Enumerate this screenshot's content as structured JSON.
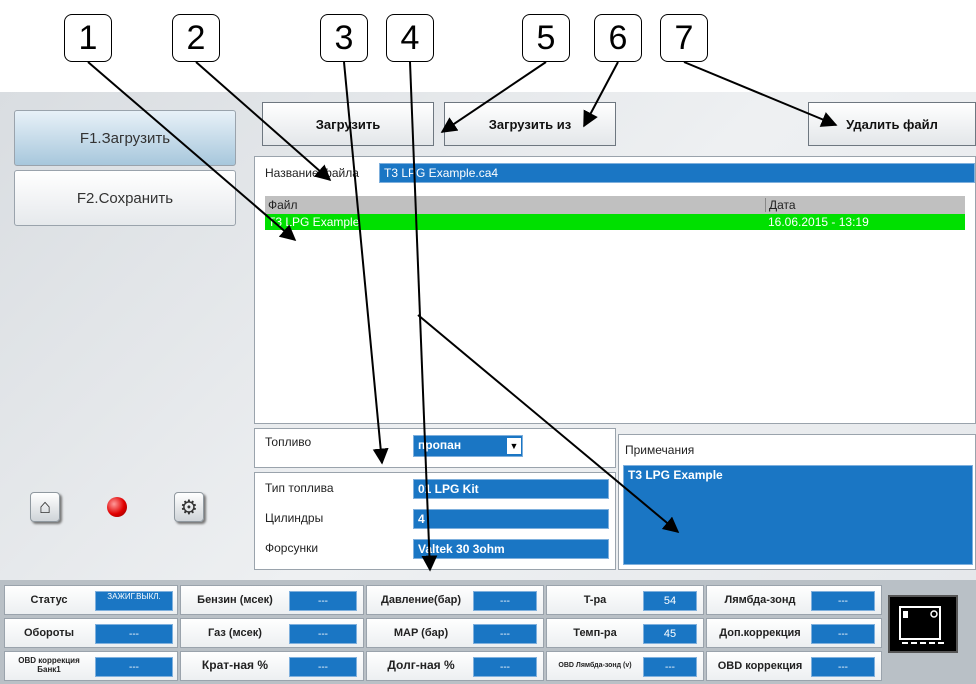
{
  "callouts": [
    "1",
    "2",
    "3",
    "4",
    "5",
    "6",
    "7"
  ],
  "sidebar": {
    "load_label": "F1.Загрузить",
    "save_label": "F2.Сохранить"
  },
  "toolbar": {
    "load": "Загрузить",
    "load_from": "Загрузить из",
    "delete": "Удалить файл"
  },
  "file": {
    "name_label": "Название файла",
    "name_value": "T3 LPG Example.ca4",
    "columns": [
      "Файл",
      "Дата"
    ],
    "rows": [
      {
        "name": "T3 LPG Example",
        "date": "16.06.2015 - 13:19"
      }
    ]
  },
  "fuel": {
    "label": "Топливо",
    "value": "пропан"
  },
  "info": {
    "fuel_type_label": "Тип топлива",
    "fuel_type_value": "01 LPG Kit",
    "cylinders_label": "Цилиндры",
    "cylinders_value": "4",
    "injectors_label": "Форсунки",
    "injectors_value": "Valtek 30 3ohm"
  },
  "notes": {
    "label": "Примечания",
    "value": "T3 LPG Example"
  },
  "status": {
    "status": "Статус",
    "status_value": "ЗАЖИГ.ВЫКЛ.",
    "rpm": "Обороты",
    "rpm_value": "---",
    "obd_corr_bank1": "OBD коррекция Банк1",
    "obd_corr_bank1_value": "---",
    "petrol": "Бензин (мсек)",
    "petrol_value": "---",
    "gas": "Газ (мсек)",
    "gas_value": "---",
    "short_pct": "Крат-ная %",
    "short_pct_value": "---",
    "pressure": "Давление(бар)",
    "pressure_value": "---",
    "map": "MAP (бар)",
    "map_value": "---",
    "long_pct": "Долг-ная %",
    "long_pct_value": "---",
    "temp": "T-ра",
    "temp_value": "54",
    "temp2": "Темп-ра",
    "temp2_value": "45",
    "obd_lambda": "OBD Лямбда-зонд (v)",
    "obd_lambda_value": "---",
    "lambda": "Лямбда-зонд",
    "lambda_value": "---",
    "extra_corr": "Доп.коррекция",
    "extra_corr_value": "---",
    "obd_corr": "OBD коррекция",
    "obd_corr_value": "---"
  }
}
